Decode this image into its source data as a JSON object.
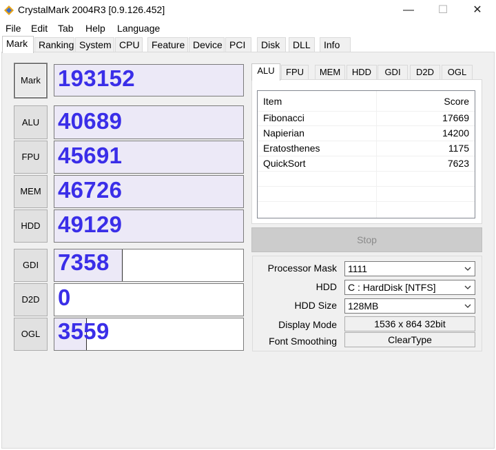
{
  "window": {
    "title": "CrystalMark 2004R3 [0.9.126.452]",
    "minimize_glyph": "—",
    "maximize_glyph": "☐",
    "close_glyph": "✕",
    "icon": "crystalmark-app-icon"
  },
  "menu": [
    "File",
    "Edit",
    "Tab",
    "Help",
    "Language"
  ],
  "tabs": [
    "Mark",
    "Ranking",
    "System",
    "CPU",
    "Feature",
    "Device",
    "PCI",
    "Disk",
    "DLL",
    "Info"
  ],
  "active_tab": "Mark",
  "scores": [
    {
      "label": "Mark",
      "value": "193152"
    },
    {
      "label": "ALU",
      "value": "40689"
    },
    {
      "label": "FPU",
      "value": "45691"
    },
    {
      "label": "MEM",
      "value": "46726"
    },
    {
      "label": "HDD",
      "value": "49129"
    },
    {
      "label": "GDI",
      "value": "7358"
    },
    {
      "label": "D2D",
      "value": "0"
    },
    {
      "label": "OGL",
      "value": "3559"
    }
  ],
  "score_bar_fill_percent": [
    100,
    100,
    100,
    100,
    100,
    36,
    0,
    17
  ],
  "subtabs": [
    "ALU",
    "FPU",
    "MEM",
    "HDD",
    "GDI",
    "D2D",
    "OGL"
  ],
  "active_subtab": "ALU",
  "alu_table": {
    "headers": [
      "Item",
      "Score"
    ],
    "rows": [
      [
        "Fibonacci",
        "17669"
      ],
      [
        "Napierian",
        "14200"
      ],
      [
        "Eratosthenes",
        "1175"
      ],
      [
        "QuickSort",
        "7623"
      ]
    ]
  },
  "stop_label": "Stop",
  "settings": {
    "processor_mask_label": "Processor Mask",
    "processor_mask_value": "1111",
    "hdd_label": "HDD",
    "hdd_value": "C : HardDisk [NTFS]",
    "hdd_size_label": "HDD Size",
    "hdd_size_value": "128MB",
    "display_mode_label": "Display Mode",
    "display_mode_value": "1536 x 864 32bit",
    "font_smoothing_label": "Font Smoothing",
    "font_smoothing_value": "ClearType"
  },
  "colors": {
    "score_text": "#3a2ee8",
    "score_fill": "#ece9f7",
    "panel_bg": "#f0f0f0"
  }
}
